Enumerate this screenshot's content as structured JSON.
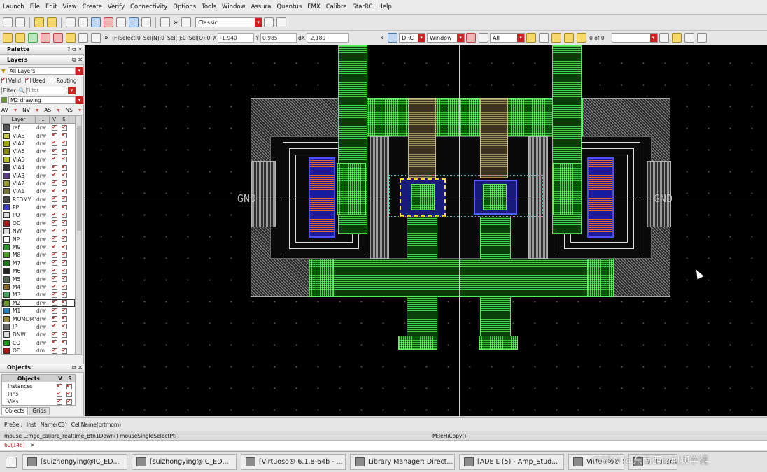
{
  "menu": [
    "Launch",
    "File",
    "Edit",
    "View",
    "Create",
    "Verify",
    "Connectivity",
    "Options",
    "Tools",
    "Window",
    "Assura",
    "Quantus",
    "EMX",
    "Calibre",
    "StarRC",
    "Help"
  ],
  "toolbar1": {
    "view_mode": "Classic"
  },
  "toolbar2": {
    "select_info": "(F)Select:0",
    "sel_n": "Sel(N):0",
    "sel_i": "Sel(I):0",
    "sel_o": "Sel(O):0",
    "x_label": "X",
    "x_value": "-1.940",
    "y_label": "Y",
    "y_value": "0.985",
    "dx_label": "dX",
    "dx_value": "-2.180",
    "drc": "DRC",
    "window": "Window",
    "all": "All",
    "counter": "0 of 0"
  },
  "palette": {
    "title": "Palette",
    "layers_title": "Layers",
    "all_layers": "All Layers",
    "valid": "Valid",
    "used": "Used",
    "routing": "Routing",
    "filter_label": "Filter",
    "filter_placeholder": "Filter",
    "current_layer": "M2 drawing",
    "av": "AV",
    "nv": "NV",
    "as": "AS",
    "ns": "NS",
    "col_layer": "Layer",
    "col_purpose": "...",
    "col_v": "V",
    "col_s": "S",
    "layers": [
      {
        "name": "ref",
        "purpose": "drw",
        "color": "#555555"
      },
      {
        "name": "VIA8",
        "purpose": "drw",
        "color": "#c9c94a"
      },
      {
        "name": "VIA7",
        "purpose": "drw",
        "color": "#a3a300"
      },
      {
        "name": "VIA6",
        "purpose": "drw",
        "color": "#888800"
      },
      {
        "name": "VIA5",
        "purpose": "drw",
        "color": "#bbbb33"
      },
      {
        "name": "VIA4",
        "purpose": "drw",
        "color": "#333333"
      },
      {
        "name": "VIA3",
        "purpose": "drw",
        "color": "#5a3e8a"
      },
      {
        "name": "VIA2",
        "purpose": "drw",
        "color": "#9a9a2a"
      },
      {
        "name": "VIA1",
        "purpose": "drw",
        "color": "#777733"
      },
      {
        "name": "RFDMY",
        "purpose": "drw",
        "color": "#444444"
      },
      {
        "name": "PP",
        "purpose": "drw",
        "color": "#3b3bd0"
      },
      {
        "name": "PO",
        "purpose": "drw",
        "color": "#e0e0e0"
      },
      {
        "name": "OD",
        "purpose": "drw",
        "color": "#b01818"
      },
      {
        "name": "NW",
        "purpose": "drw",
        "color": "#dddddd"
      },
      {
        "name": "NP",
        "purpose": "drw",
        "color": "#ffffff"
      },
      {
        "name": "M9",
        "purpose": "drw",
        "color": "#2a9a2a"
      },
      {
        "name": "M8",
        "purpose": "drw",
        "color": "#4aa020"
      },
      {
        "name": "M7",
        "purpose": "drw",
        "color": "#1a7a1a"
      },
      {
        "name": "M6",
        "purpose": "drw",
        "color": "#222222"
      },
      {
        "name": "M5",
        "purpose": "drw",
        "color": "#556655"
      },
      {
        "name": "M4",
        "purpose": "drw",
        "color": "#8a6a2a"
      },
      {
        "name": "M3",
        "purpose": "drw",
        "color": "#3aa05a"
      },
      {
        "name": "M2",
        "purpose": "drw",
        "color": "#6a9a2a"
      },
      {
        "name": "M1",
        "purpose": "drw",
        "color": "#2080c0"
      },
      {
        "name": "MOMDMY",
        "purpose": "drw",
        "color": "#9a8a3a"
      },
      {
        "name": "IP",
        "purpose": "drw",
        "color": "#666666"
      },
      {
        "name": "DNW",
        "purpose": "drw",
        "color": "#dddddd"
      },
      {
        "name": "CO",
        "purpose": "drw",
        "color": "#1a9a1a"
      },
      {
        "name": "OD",
        "purpose": "dm",
        "color": "#aa1111"
      }
    ],
    "objects_title": "Objects",
    "objects_col": "Objects",
    "obj_v": "V",
    "obj_s": "S",
    "objects": [
      "Instances",
      "Pins",
      "Vias"
    ],
    "tabs": [
      "Objects",
      "Grids"
    ]
  },
  "canvas": {
    "gnd_labels": [
      "GND",
      "GND"
    ]
  },
  "status": {
    "presel": "PreSel:",
    "inst": "Inst",
    "name": "Name(C3)",
    "cell": "CellName(crtmom)",
    "mouse": "mouse L:mgc_calibre_realtime_Btn1Down() mouseSingleSelectPt()",
    "mid": "M:leHiCopy()",
    "prompt": "60(148)",
    "prompt2": ">"
  },
  "taskbar": [
    {
      "label": "[suizhongying@IC_ED..."
    },
    {
      "label": "[suizhongying@IC_ED..."
    },
    {
      "label": "[Virtuoso® 6.1.8-64b - ..."
    },
    {
      "label": "Library Manager: Direct..."
    },
    {
      "label": "[ADE L (5) - Amp_Stud..."
    },
    {
      "label": "Virtuoso® Schematic E..."
    },
    {
      "label": "Virtuoso® Layout Suite"
    }
  ],
  "watermark": "CSDN @东南西的射频学徒"
}
